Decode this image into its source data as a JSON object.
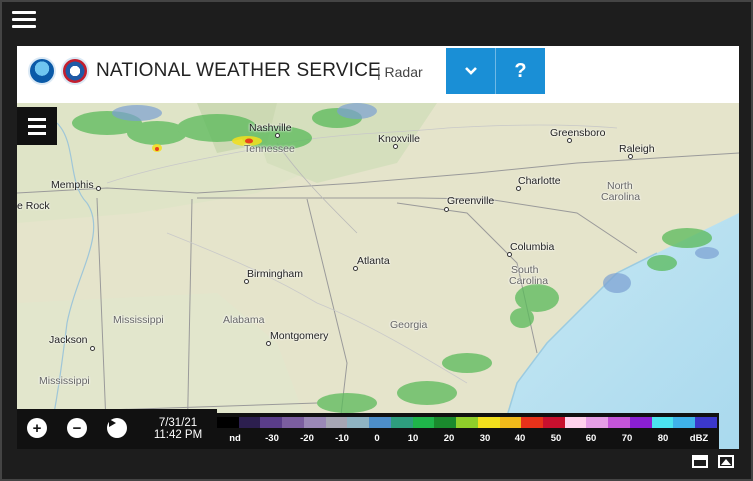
{
  "app": {
    "title": "NATIONAL WEATHER SERVICE",
    "subtitle": "| Radar",
    "dropdown_icon": "chevron-down-icon",
    "help_label": "?"
  },
  "map": {
    "cities": [
      {
        "name": "Nashville"
      },
      {
        "name": "Knoxville"
      },
      {
        "name": "Greensboro"
      },
      {
        "name": "Raleigh"
      },
      {
        "name": "Memphis"
      },
      {
        "name": "Charlotte"
      },
      {
        "name": "Greenville"
      },
      {
        "name": "Columbia"
      },
      {
        "name": "Atlanta"
      },
      {
        "name": "Birmingham"
      },
      {
        "name": "Montgomery"
      },
      {
        "name": "Jackson"
      },
      {
        "name": "e Rock"
      }
    ],
    "states": [
      {
        "name": "Tennessee"
      },
      {
        "name": "North"
      },
      {
        "name": "Carolina"
      },
      {
        "name": "South"
      },
      {
        "name": "Carolina"
      },
      {
        "name": "Mississippi"
      },
      {
        "name": "Alabama"
      },
      {
        "name": "Georgia"
      },
      {
        "name": "Mississippi"
      }
    ]
  },
  "controls": {
    "zoom_in": "+",
    "zoom_out": "−",
    "play": "▶",
    "date": "7/31/21",
    "time": "11:42 PM"
  },
  "legend": {
    "labels": [
      "nd",
      "-30",
      "-20",
      "-10",
      "0",
      "10",
      "20",
      "30",
      "40",
      "50",
      "60",
      "70",
      "80",
      "dBZ"
    ],
    "colors": [
      "#000000",
      "#2c1f4f",
      "#5a3d8a",
      "#7b5ea0",
      "#9a88b7",
      "#a6a6b4",
      "#8fb3c2",
      "#4d8ec9",
      "#2e9e7e",
      "#1fb54a",
      "#1a8a2d",
      "#8fcf2a",
      "#f2e01d",
      "#f0b91a",
      "#e8321a",
      "#c8102e",
      "#ffd1ec",
      "#e69ee6",
      "#c455d8",
      "#8a1fd1",
      "#4be3ef",
      "#3fb2ea",
      "#3b38cc"
    ]
  },
  "colors": {
    "accent": "#1a8fd6",
    "dark": "#111111"
  }
}
